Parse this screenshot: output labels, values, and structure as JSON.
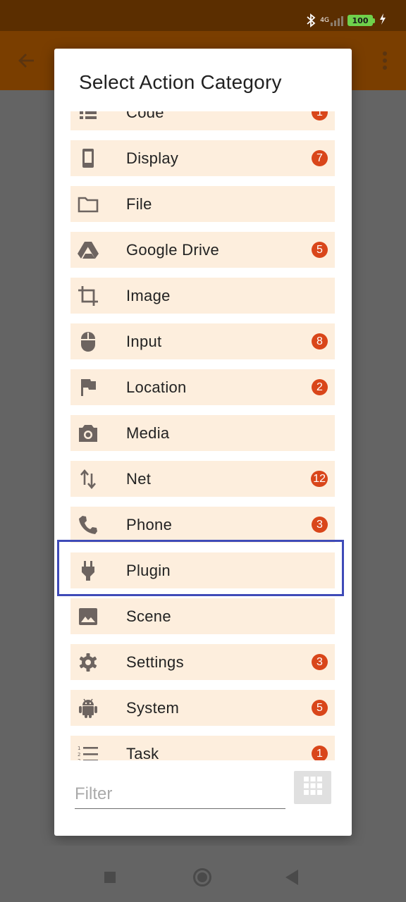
{
  "status_bar": {
    "network_label": "4G",
    "battery_level": "100",
    "icons": [
      "bluetooth-icon",
      "signal-icon",
      "battery-icon",
      "charging-icon"
    ]
  },
  "app_bar": {
    "icons": [
      "back-arrow-icon",
      "more-vert-icon"
    ],
    "color": "#7a3e00"
  },
  "dialog": {
    "title": "Select Action Category",
    "filter_placeholder": "Filter",
    "filter_value": "",
    "grid_button_icon": "grid-icon",
    "highlighted_item": "Plugin",
    "items": [
      {
        "label": "Code",
        "icon": "code-list-icon",
        "badge": "1"
      },
      {
        "label": "Display",
        "icon": "phone-display-icon",
        "badge": "7"
      },
      {
        "label": "File",
        "icon": "folder-icon",
        "badge": ""
      },
      {
        "label": "Google Drive",
        "icon": "google-drive-icon",
        "badge": "5"
      },
      {
        "label": "Image",
        "icon": "crop-icon",
        "badge": ""
      },
      {
        "label": "Input",
        "icon": "mouse-icon",
        "badge": "8"
      },
      {
        "label": "Location",
        "icon": "flag-icon",
        "badge": "2"
      },
      {
        "label": "Media",
        "icon": "camera-icon",
        "badge": ""
      },
      {
        "label": "Net",
        "icon": "swap-vert-icon",
        "badge": "12"
      },
      {
        "label": "Phone",
        "icon": "phone-icon",
        "badge": "3"
      },
      {
        "label": "Plugin",
        "icon": "plug-icon",
        "badge": ""
      },
      {
        "label": "Scene",
        "icon": "image-icon",
        "badge": ""
      },
      {
        "label": "Settings",
        "icon": "gear-icon",
        "badge": "3"
      },
      {
        "label": "System",
        "icon": "android-icon",
        "badge": "5"
      },
      {
        "label": "Task",
        "icon": "task-list-icon",
        "badge": "1"
      }
    ]
  },
  "colors": {
    "row_background": "#fdeedd",
    "badge": "#d9461a",
    "highlight_border": "#3f4bb8",
    "icon": "#6d6460"
  },
  "nav_bar": {
    "icons": [
      "recents-square-icon",
      "home-circle-icon",
      "back-triangle-icon"
    ]
  }
}
